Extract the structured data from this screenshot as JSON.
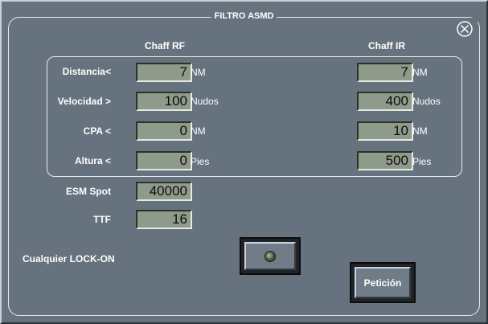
{
  "panel": {
    "title": "FILTRO ASMD"
  },
  "columns": {
    "rf": "Chaff RF",
    "ir": "Chaff IR"
  },
  "rows": [
    {
      "label": "Distancia<",
      "rf_value": "7",
      "rf_unit": "NM",
      "ir_value": "7",
      "ir_unit": "NM"
    },
    {
      "label": "Velocidad >",
      "rf_value": "100",
      "rf_unit": "Nudos",
      "ir_value": "400",
      "ir_unit": "Nudos"
    },
    {
      "label": "CPA <",
      "rf_value": "0",
      "rf_unit": "NM",
      "ir_value": "10",
      "ir_unit": "NM"
    },
    {
      "label": "Altura <",
      "rf_value": "0",
      "rf_unit": "Pies",
      "ir_value": "500",
      "ir_unit": "Pies"
    }
  ],
  "esm": {
    "label": "ESM Spot",
    "value": "40000"
  },
  "ttf": {
    "label": "TTF",
    "value": "16"
  },
  "lock": {
    "label": "Cualquier LOCK-ON"
  },
  "buttons": {
    "peticion": "Petición"
  },
  "icons": {
    "close": "close-circle-icon",
    "led": "led-indicator-icon"
  }
}
